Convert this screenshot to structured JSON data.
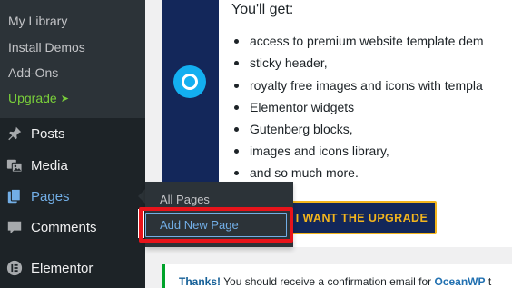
{
  "sidebar": {
    "submenu": [
      {
        "label": "My Library"
      },
      {
        "label": "Install Demos"
      },
      {
        "label": "Add-Ons"
      },
      {
        "label": "Upgrade",
        "arrow": "➤"
      }
    ],
    "menu": [
      {
        "label": "Posts",
        "icon": "pushpin-icon"
      },
      {
        "label": "Media",
        "icon": "media-icon"
      },
      {
        "label": "Pages",
        "icon": "pages-icon"
      },
      {
        "label": "Comments",
        "icon": "comment-icon"
      },
      {
        "label": "Elementor",
        "icon": "elementor-icon"
      }
    ]
  },
  "flyout": {
    "items": [
      {
        "label": "All Pages"
      },
      {
        "label": "Add New Page"
      }
    ]
  },
  "promo": {
    "heading": "You'll get:",
    "features": [
      "access to premium website template dem",
      "sticky header,",
      "royalty free images and icons with templa",
      "Elementor widgets",
      "Gutenberg blocks,",
      "images and icons library,",
      "and so much more."
    ],
    "button_label": "I WANT THE UPGRADE"
  },
  "notice": {
    "strong": "Thanks!",
    "text_before": " You should receive a confirmation email for ",
    "brand": "OceanWP",
    "text_after": " t"
  },
  "colors": {
    "sidebar_bg": "#1d2327",
    "submenu_bg": "#2c3338",
    "accent_blue": "#72aee6",
    "upgrade_green": "#7ad03a",
    "highlight_red": "#e8141b",
    "button_gold": "#f3b51d",
    "promo_navy": "#13275a"
  }
}
